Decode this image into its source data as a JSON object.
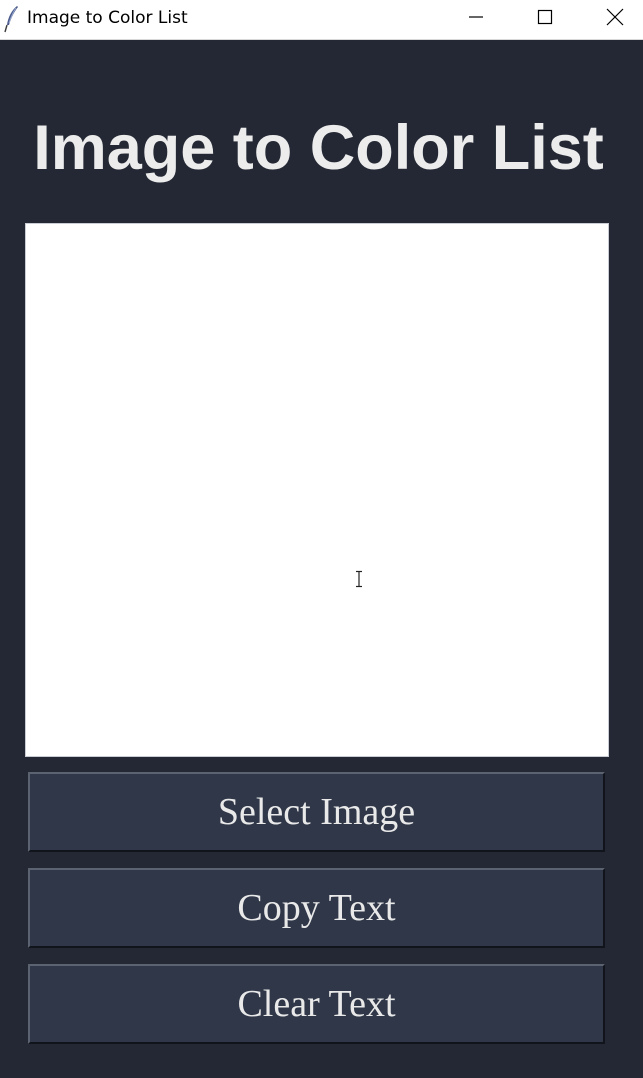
{
  "window": {
    "title": "Image to Color List",
    "icon": "feather-icon",
    "controls": [
      "minimize-icon",
      "maximize-icon",
      "close-icon"
    ]
  },
  "main": {
    "heading": "Image to Color List",
    "text_area": {
      "value": "",
      "cursor": "text-cursor-icon"
    },
    "buttons": {
      "select_image": "Select Image",
      "copy_text": "Copy Text",
      "clear_text": "Clear Text"
    }
  },
  "colors": {
    "background": "#232834",
    "button_bg": "#2f3748",
    "heading_text": "#ececec",
    "button_text": "#e9e9e9",
    "text_area_bg": "#ffffff"
  }
}
